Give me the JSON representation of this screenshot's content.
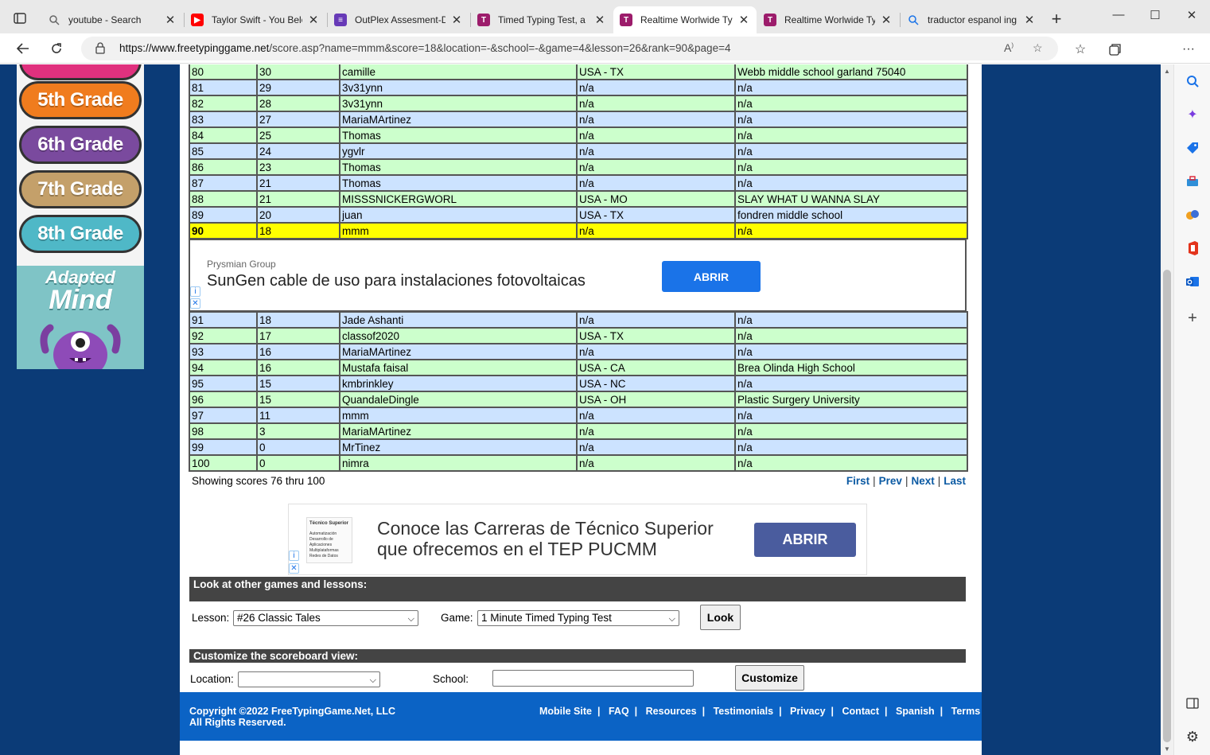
{
  "browser": {
    "tabs": [
      {
        "title": "youtube - Search",
        "icon": "search-icon"
      },
      {
        "title": "Taylor Swift - You Belo",
        "icon": "youtube-icon"
      },
      {
        "title": "OutPlex Assesment-D",
        "icon": "form-icon"
      },
      {
        "title": "Timed Typing Test, a",
        "icon": "site-t-icon"
      },
      {
        "title": "Realtime Worlwide Ty",
        "icon": "site-t-icon"
      },
      {
        "title": "Realtime Worlwide Ty",
        "icon": "site-t-icon"
      },
      {
        "title": "traductor espanol ing",
        "icon": "search-icon"
      }
    ],
    "address": {
      "domain": "https://www.freetypinggame.net",
      "path": "/score.asp?name=mmm&score=18&location=-&school=-&game=4&lesson=26&rank=90&page=4"
    }
  },
  "sidebar": {
    "grades": [
      "5th Grade",
      "6th Grade",
      "7th Grade",
      "8th Grade"
    ],
    "adapted_line1": "Adapted",
    "adapted_line2": "Mind"
  },
  "scores": {
    "rows_top": [
      {
        "rank": "80",
        "score": "30",
        "name": "camille",
        "location": "USA - TX",
        "school": "Webb middle school garland 75040"
      },
      {
        "rank": "81",
        "score": "29",
        "name": "3v31ynn",
        "location": "n/a",
        "school": "n/a"
      },
      {
        "rank": "82",
        "score": "28",
        "name": "3v31ynn",
        "location": "n/a",
        "school": "n/a"
      },
      {
        "rank": "83",
        "score": "27",
        "name": "MariaMArtinez",
        "location": "n/a",
        "school": "n/a"
      },
      {
        "rank": "84",
        "score": "25",
        "name": "Thomas",
        "location": "n/a",
        "school": "n/a"
      },
      {
        "rank": "85",
        "score": "24",
        "name": "ygvlr",
        "location": "n/a",
        "school": "n/a"
      },
      {
        "rank": "86",
        "score": "23",
        "name": "Thomas",
        "location": "n/a",
        "school": "n/a"
      },
      {
        "rank": "87",
        "score": "21",
        "name": "Thomas",
        "location": "n/a",
        "school": "n/a"
      },
      {
        "rank": "88",
        "score": "21",
        "name": "MISSSNICKERGWORL",
        "location": "USA - MO",
        "school": "SLAY WHAT U WANNA SLAY"
      },
      {
        "rank": "89",
        "score": "20",
        "name": "juan",
        "location": "USA - TX",
        "school": "fondren middle school"
      },
      {
        "rank": "90",
        "score": "18",
        "name": "mmm",
        "location": "n/a",
        "school": "n/a"
      }
    ],
    "rows_bottom": [
      {
        "rank": "91",
        "score": "18",
        "name": "Jade Ashanti",
        "location": "n/a",
        "school": "n/a"
      },
      {
        "rank": "92",
        "score": "17",
        "name": "classof2020",
        "location": "USA - TX",
        "school": "n/a"
      },
      {
        "rank": "93",
        "score": "16",
        "name": "MariaMArtinez",
        "location": "n/a",
        "school": "n/a"
      },
      {
        "rank": "94",
        "score": "16",
        "name": "Mustafa faisal",
        "location": "USA - CA",
        "school": "Brea Olinda High School"
      },
      {
        "rank": "95",
        "score": "15",
        "name": "kmbrinkley",
        "location": "USA - NC",
        "school": "n/a"
      },
      {
        "rank": "96",
        "score": "15",
        "name": "QuandaleDingle",
        "location": "USA - OH",
        "school": "Plastic Surgery University"
      },
      {
        "rank": "97",
        "score": "11",
        "name": "mmm",
        "location": "n/a",
        "school": "n/a"
      },
      {
        "rank": "98",
        "score": "3",
        "name": "MariaMArtinez",
        "location": "n/a",
        "school": "n/a"
      },
      {
        "rank": "99",
        "score": "0",
        "name": "MrTinez",
        "location": "n/a",
        "school": "n/a"
      },
      {
        "rank": "100",
        "score": "0",
        "name": "nimra",
        "location": "n/a",
        "school": "n/a"
      }
    ],
    "highlight_color": "#ffff00"
  },
  "ad_inline": {
    "advertiser": "Prysmian Group",
    "headline": "SunGen cable de uso para instalaciones fotovoltaicas",
    "cta": "ABRIR"
  },
  "pagination": {
    "showing": "Showing scores 76 thru 100",
    "first": "First",
    "prev": "Prev",
    "next": "Next",
    "last": "Last"
  },
  "ad_banner": {
    "headline": "Conoce las Carreras de Técnico Superior que ofrecemos en el TEP PUCMM",
    "cta": "ABRIR",
    "thumb_title": "Técnico Superior",
    "thumb_items": [
      "Automatización",
      "Desarrollo de Aplicaciones Multiplataformas",
      "Redes de Datos"
    ]
  },
  "lookup": {
    "title": "Look at other games and lessons:",
    "lesson_label": "Lesson:",
    "lesson_value": "#26 Classic Tales",
    "game_label": "Game:",
    "game_value": "1 Minute Timed Typing Test",
    "look_button": "Look"
  },
  "customize": {
    "title": "Customize the scoreboard view:",
    "location_label": "Location:",
    "location_value": "",
    "school_label": "School:",
    "school_value": "",
    "customize_button": "Customize"
  },
  "footer": {
    "copyright": "Copyright ©2022 FreeTypingGame.Net, LLC",
    "rights": "All Rights Reserved.",
    "links": [
      "Mobile Site",
      "FAQ",
      "Resources",
      "Testimonials",
      "Privacy",
      "Contact",
      "Spanish",
      "Terms"
    ]
  },
  "colors": {
    "row_green": "#ccffcc",
    "row_blue": "#cce3ff",
    "page_bg": "#0b3b77",
    "footer_bg": "#0b63c5",
    "grade_5": "#f07c1e",
    "grade_6": "#7a4a9e",
    "grade_7": "#c4a06a",
    "grade_8": "#4fb8c7"
  }
}
